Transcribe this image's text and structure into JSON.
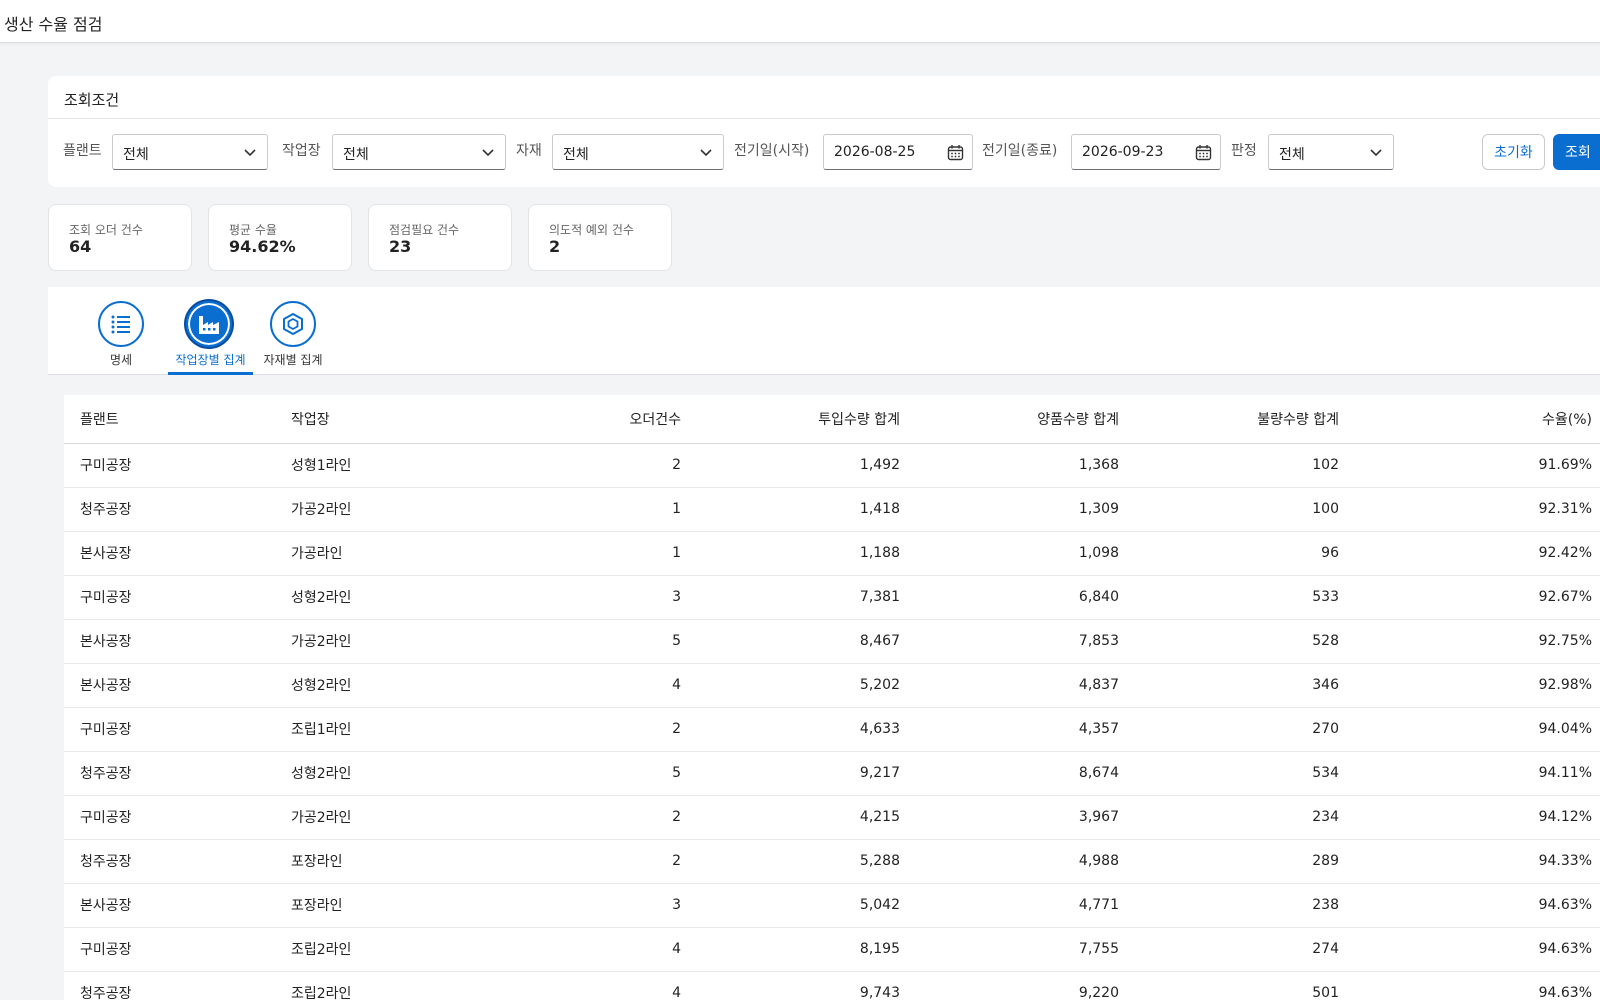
{
  "app": {
    "title": "생산 수율 점검"
  },
  "conditions": {
    "title": "조회조건",
    "plant": {
      "label": "플랜트",
      "value": "전체"
    },
    "workcenter": {
      "label": "작업장",
      "value": "전체"
    },
    "material": {
      "label": "자재",
      "value": "전체"
    },
    "date_from": {
      "label": "전기일(시작)",
      "value": "2026-08-25"
    },
    "date_to": {
      "label": "전기일(종료)",
      "value": "2026-09-23"
    },
    "judgement": {
      "label": "판정",
      "value": "전체"
    },
    "reset_label": "초기화",
    "search_label": "조회"
  },
  "kpis": [
    {
      "label": "조회 오더 건수",
      "value": "64"
    },
    {
      "label": "평균 수율",
      "value": "94.62%"
    },
    {
      "label": "점검필요 건수",
      "value": "23"
    },
    {
      "label": "의도적 예외 건수",
      "value": "2"
    }
  ],
  "tabs": [
    {
      "label": "명세",
      "icon": "list-icon",
      "active": false
    },
    {
      "label": "작업장별 집계",
      "icon": "factory-icon",
      "active": true
    },
    {
      "label": "자재별 집계",
      "icon": "product-box-icon",
      "active": false
    }
  ],
  "table": {
    "headers": [
      "플랜트",
      "작업장",
      "오더건수",
      "투입수량 합계",
      "양품수량 합계",
      "불량수량 합계",
      "수율(%)"
    ],
    "rows": [
      [
        "구미공장",
        "성형1라인",
        "2",
        "1,492",
        "1,368",
        "102",
        "91.69%"
      ],
      [
        "청주공장",
        "가공2라인",
        "1",
        "1,418",
        "1,309",
        "100",
        "92.31%"
      ],
      [
        "본사공장",
        "가공라인",
        "1",
        "1,188",
        "1,098",
        "96",
        "92.42%"
      ],
      [
        "구미공장",
        "성형2라인",
        "3",
        "7,381",
        "6,840",
        "533",
        "92.67%"
      ],
      [
        "본사공장",
        "가공2라인",
        "5",
        "8,467",
        "7,853",
        "528",
        "92.75%"
      ],
      [
        "본사공장",
        "성형2라인",
        "4",
        "5,202",
        "4,837",
        "346",
        "92.98%"
      ],
      [
        "구미공장",
        "조립1라인",
        "2",
        "4,633",
        "4,357",
        "270",
        "94.04%"
      ],
      [
        "청주공장",
        "성형2라인",
        "5",
        "9,217",
        "8,674",
        "534",
        "94.11%"
      ],
      [
        "구미공장",
        "가공2라인",
        "2",
        "4,215",
        "3,967",
        "234",
        "94.12%"
      ],
      [
        "청주공장",
        "포장라인",
        "2",
        "5,288",
        "4,988",
        "289",
        "94.33%"
      ],
      [
        "본사공장",
        "포장라인",
        "3",
        "5,042",
        "4,771",
        "238",
        "94.63%"
      ],
      [
        "구미공장",
        "조립2라인",
        "4",
        "8,195",
        "7,755",
        "274",
        "94.63%"
      ],
      [
        "청주공장",
        "조립2라인",
        "4",
        "9,743",
        "9,220",
        "501",
        "94.63%"
      ]
    ]
  },
  "colors": {
    "accent": "#0a6ed1",
    "background": "#f3f4f6"
  }
}
